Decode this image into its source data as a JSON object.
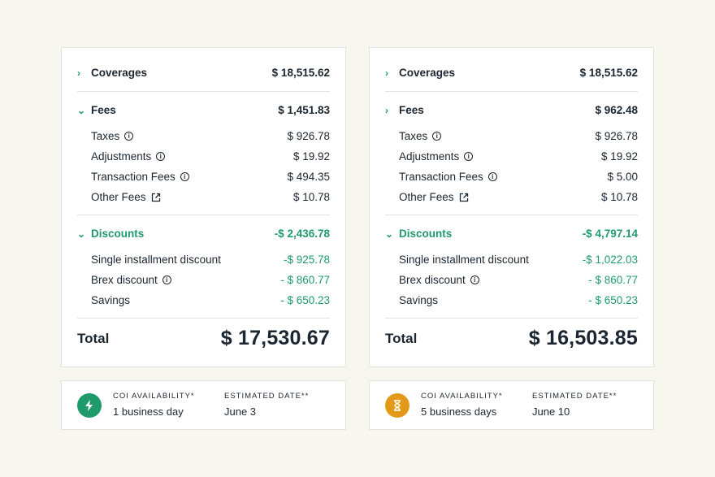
{
  "colors": {
    "accent_green": "#1f9b6b",
    "accent_orange": "#e39a1a",
    "text": "#1b2630",
    "background": "#f7f7ef"
  },
  "panels": [
    {
      "coverages": {
        "label": "Coverages",
        "value": "$ 18,515.62",
        "icon": "chevron-right-icon"
      },
      "fees": {
        "label": "Fees",
        "value": "$ 1,451.83",
        "icon": "chevron-down-icon",
        "items": [
          {
            "label": "Taxes",
            "value": "$ 926.78",
            "icon": "info-icon"
          },
          {
            "label": "Adjustments",
            "value": "$ 19.92",
            "icon": "info-icon"
          },
          {
            "label": "Transaction Fees",
            "value": "$ 494.35",
            "icon": "info-icon"
          },
          {
            "label": "Other Fees",
            "value": "$ 10.78",
            "icon": "external-link-icon"
          }
        ]
      },
      "discounts": {
        "label": "Discounts",
        "value": "-$ 2,436.78",
        "icon": "chevron-down-icon",
        "items": [
          {
            "label": "Single installment discount",
            "value": "-$ 925.78"
          },
          {
            "label": "Brex discount",
            "value": "- $ 860.77",
            "icon": "info-icon"
          },
          {
            "label": "Savings",
            "value": "- $ 650.23"
          }
        ]
      },
      "total": {
        "label": "Total",
        "value": "$ 17,530.67"
      },
      "coi": {
        "icon": "lightning-icon",
        "availability_label": "COI AVAILABILITY*",
        "availability_value": "1 business day",
        "date_label": "ESTIMATED DATE**",
        "date_value": "June 3"
      }
    },
    {
      "coverages": {
        "label": "Coverages",
        "value": "$ 18,515.62",
        "icon": "chevron-right-icon"
      },
      "fees": {
        "label": "Fees",
        "value": "$ 962.48",
        "icon": "chevron-right-icon",
        "items": [
          {
            "label": "Taxes",
            "value": "$ 926.78",
            "icon": "info-icon"
          },
          {
            "label": "Adjustments",
            "value": "$ 19.92",
            "icon": "info-icon"
          },
          {
            "label": "Transaction Fees",
            "value": "$ 5.00",
            "icon": "info-icon"
          },
          {
            "label": "Other Fees",
            "value": "$ 10.78",
            "icon": "external-link-icon"
          }
        ]
      },
      "discounts": {
        "label": "Discounts",
        "value": "-$ 4,797.14",
        "icon": "chevron-down-icon",
        "items": [
          {
            "label": "Single installment discount",
            "value": "-$ 1,022.03"
          },
          {
            "label": "Brex discount",
            "value": "- $ 860.77",
            "icon": "info-icon"
          },
          {
            "label": "Savings",
            "value": "- $ 650.23"
          }
        ]
      },
      "total": {
        "label": "Total",
        "value": "$ 16,503.85"
      },
      "coi": {
        "icon": "hourglass-icon",
        "availability_label": "COI AVAILABILITY*",
        "availability_value": "5 business days",
        "date_label": "ESTIMATED DATE**",
        "date_value": "June 10"
      }
    }
  ]
}
